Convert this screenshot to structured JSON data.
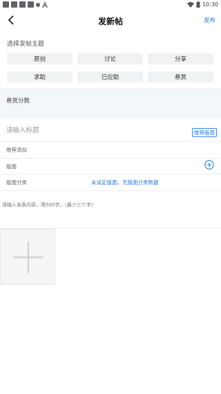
{
  "status_bar": {
    "time": "10:30"
  },
  "header": {
    "title": "发新帖",
    "publish_label": "发布"
  },
  "topic": {
    "label": "选择发帖主题",
    "options": [
      "原创",
      "讨论",
      "分享",
      "求助",
      "已应助",
      "悬赏"
    ]
  },
  "reward": {
    "label": "悬赏分数"
  },
  "form": {
    "title_placeholder": "请输入标题",
    "recommend_board_label": "推荐版面",
    "recommend_add_label": "推荐添加",
    "board_label": "版面",
    "category_label": "版面分类",
    "category_value": "未设定版面，无版面分类数据",
    "content_placeholder": "请输入发表内容，限500字。（最少三个字）"
  },
  "colors": {
    "accent": "#2b7be0",
    "reward_bg": "#f4f7fa",
    "button_bg": "#f1f2f4"
  },
  "icons": {
    "back": "chevron-left-icon",
    "board_add": "plus-circle-icon",
    "add_image": "plus-icon"
  }
}
